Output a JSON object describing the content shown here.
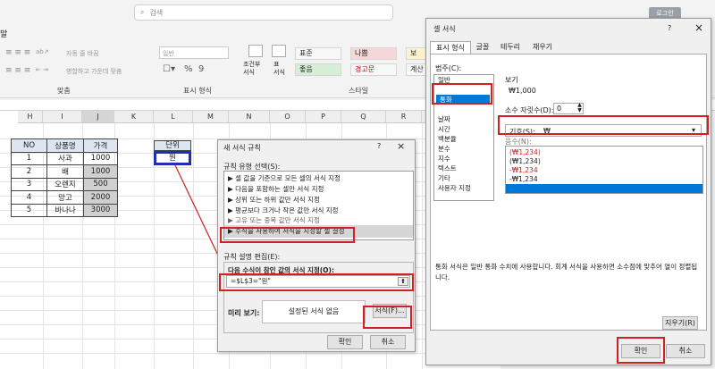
{
  "titlebar": {
    "search_placeholder": "검색",
    "login_label": "로그인",
    "menu_fragment": "말"
  },
  "ribbon": {
    "fragments": [
      "자동 줄 바꿈",
      "병합하고 가운데 맞춤",
      "일반"
    ],
    "number_symbols": [
      "%",
      "9"
    ],
    "cond_format": "조건부\n서식",
    "table_format": "표\n서식",
    "groups": {
      "align": "맞춤",
      "number": "표시 형식",
      "styles": "스타일"
    },
    "cell_styles": [
      "표준",
      "나쁨",
      "좋음",
      "경고문",
      "보",
      "계산"
    ]
  },
  "sheet": {
    "columns": [
      "H",
      "I",
      "J",
      "K",
      "L",
      "M",
      "N",
      "O",
      "P",
      "Q",
      "R"
    ],
    "table": {
      "headers": [
        "NO",
        "상품명",
        "가격"
      ],
      "rows": [
        [
          "1",
          "사과",
          "1000"
        ],
        [
          "2",
          "배",
          "1000"
        ],
        [
          "3",
          "오렌지",
          "500"
        ],
        [
          "4",
          "망고",
          "2000"
        ],
        [
          "5",
          "바나나",
          "3000"
        ]
      ]
    },
    "unit_header": "단위",
    "unit_value": "원"
  },
  "rule_dialog": {
    "title": "새 서식 규칙",
    "question": "?",
    "close": "×",
    "select_label": "규칙 유형 선택(S):",
    "rule_types": [
      "▶ 셀 값을 기준으로 모든 셀의 서식 지정",
      "▶ 다음을 포함하는 셀만 서식 지정",
      "▶ 상위 또는 하위 값만 서식 지정",
      "▶ 평균보다 크거나 작은 값만 서식 지정",
      "▶ 고유 또는 중복 값만 서식 지정",
      "▶ 수식을 사용하여 서식을 지정할 셀 결정"
    ],
    "edit_label": "규칙 설명 편집(E):",
    "formula_label": "다음 수식이 참인 값의 서식 지정(O):",
    "formula": "=$L$3=\"원\"",
    "preview_label": "미리 보기:",
    "preview_text": "설정된 서식 없음",
    "format_button": "서식(F)...",
    "ok": "확인",
    "cancel": "취소"
  },
  "format_dialog": {
    "title": "셀 서식",
    "question": "?",
    "close": "×",
    "tabs": [
      "표시 형식",
      "글꼴",
      "테두리",
      "채우기"
    ],
    "category_label": "범주(C):",
    "categories": [
      "일반",
      "숫자",
      "통화",
      "회계",
      "날짜",
      "시간",
      "백분율",
      "분수",
      "지수",
      "텍스트",
      "기타",
      "사용자 지정"
    ],
    "selected_category": "통화",
    "sample_label": "보기",
    "sample_value": "₩1,000",
    "decimals_label": "소수 자릿수(D):",
    "decimals_value": "0",
    "symbol_label": "기호(S):",
    "symbol_value": "₩",
    "negative_label": "음수(N):",
    "negatives": [
      {
        "text": "(₩1,234)",
        "red": true
      },
      {
        "text": "(₩1,234)",
        "red": false
      },
      {
        "text": "-₩1,234",
        "red": true
      },
      {
        "text": "-₩1,234",
        "red": false
      },
      {
        "text": "-₩1,234",
        "red": false,
        "selected": true
      }
    ],
    "description": "통화 서식은 일반 통화 수치에 사용합니다. 회계 서식을 사용하면 소수점에 맞추어 열이 정렬됩니다.",
    "clear_button": "지우기(R)",
    "ok": "확인",
    "cancel": "취소"
  },
  "colors": {
    "highlight_red": "#d21f1f",
    "cell_blue": "#1f2fb5",
    "select_blue": "#0078d7",
    "header_fill": "#dde5f0"
  }
}
